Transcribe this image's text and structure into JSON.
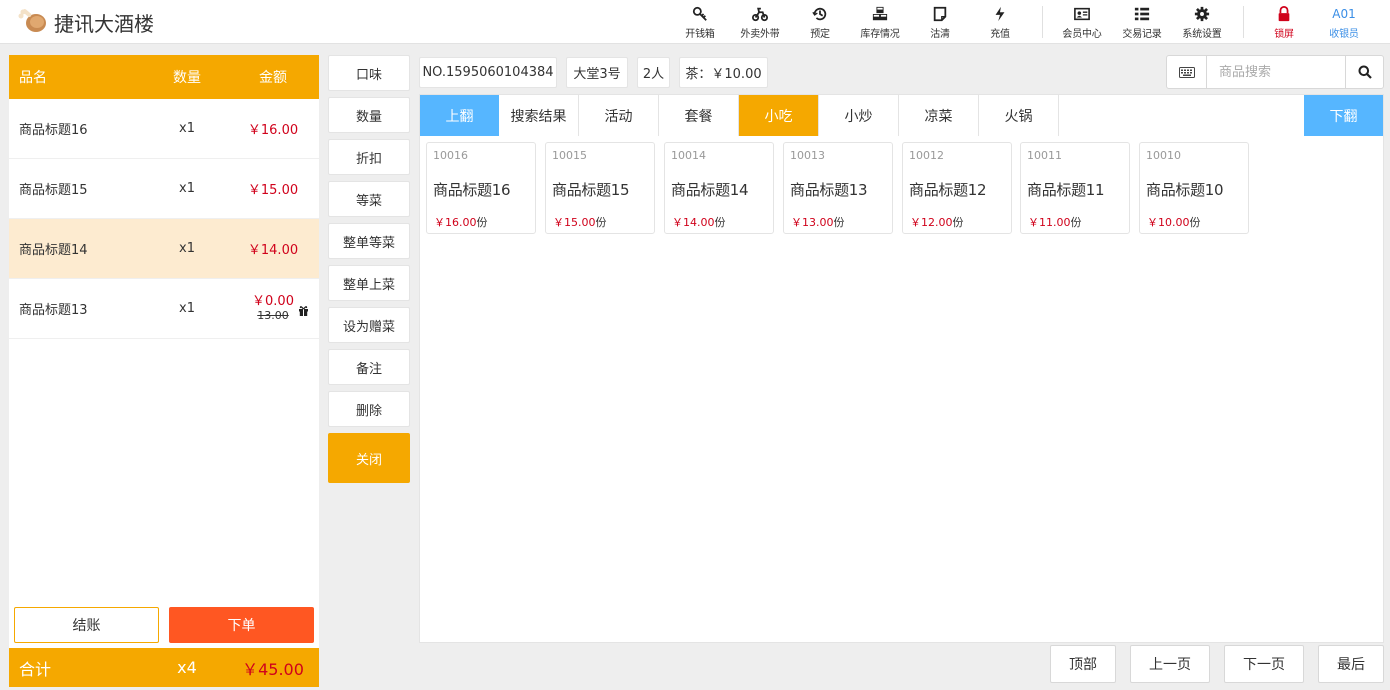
{
  "app": {
    "title": "捷讯大酒楼"
  },
  "toolbar": {
    "items": [
      {
        "label": "开钱箱",
        "icon": "key-icon"
      },
      {
        "label": "外卖外带",
        "icon": "scooter-icon"
      },
      {
        "label": "预定",
        "icon": "clock-history-icon"
      },
      {
        "label": "库存情况",
        "icon": "cubes-icon"
      },
      {
        "label": "沽清",
        "icon": "note-icon"
      },
      {
        "label": "充值",
        "icon": "bolt-icon"
      },
      {
        "label": "会员中心",
        "icon": "id-card-icon"
      },
      {
        "label": "交易记录",
        "icon": "list-icon"
      },
      {
        "label": "系统设置",
        "icon": "gear-icon"
      },
      {
        "label": "锁屏",
        "icon": "lock-icon"
      }
    ],
    "user": {
      "id": "A01",
      "role": "收银员"
    }
  },
  "order": {
    "headers": {
      "name": "品名",
      "qty": "数量",
      "amount": "金额"
    },
    "items": [
      {
        "name": "商品标题16",
        "qty": "x1",
        "amount": "￥16.00"
      },
      {
        "name": "商品标题15",
        "qty": "x1",
        "amount": "￥15.00"
      },
      {
        "name": "商品标题14",
        "qty": "x1",
        "amount": "￥14.00"
      },
      {
        "name": "商品标题13",
        "qty": "x1",
        "amount": "￥0.00",
        "original": "13.00"
      }
    ],
    "checkout_label": "结账",
    "place_order_label": "下单",
    "total": {
      "label": "合计",
      "qty": "x4",
      "amount": "￥45.00"
    }
  },
  "actions": [
    "口味",
    "数量",
    "折扣",
    "等菜",
    "整单等菜",
    "整单上菜",
    "设为赠菜",
    "备注",
    "删除",
    "关闭"
  ],
  "info": {
    "order_no": "NO.1595060104384",
    "table": "大堂3号",
    "guests": "2人",
    "tea": "茶：￥10.00"
  },
  "search": {
    "placeholder": "商品搜索"
  },
  "tabs": {
    "prev": "上翻",
    "next": "下翻",
    "items": [
      "搜索结果",
      "活动",
      "套餐",
      "小吃",
      "小炒",
      "凉菜",
      "火锅"
    ],
    "active": "小吃"
  },
  "products": [
    {
      "code": "10016",
      "name": "商品标题16",
      "price": "￥16.00",
      "unit": "份"
    },
    {
      "code": "10015",
      "name": "商品标题15",
      "price": "￥15.00",
      "unit": "份"
    },
    {
      "code": "10014",
      "name": "商品标题14",
      "price": "￥14.00",
      "unit": "份"
    },
    {
      "code": "10013",
      "name": "商品标题13",
      "price": "￥13.00",
      "unit": "份"
    },
    {
      "code": "10012",
      "name": "商品标题12",
      "price": "￥12.00",
      "unit": "份"
    },
    {
      "code": "10011",
      "name": "商品标题11",
      "price": "￥11.00",
      "unit": "份"
    },
    {
      "code": "10010",
      "name": "商品标题10",
      "price": "￥10.00",
      "unit": "份"
    }
  ],
  "pager": {
    "top": "顶部",
    "prev": "上一页",
    "next": "下一页",
    "last": "最后"
  },
  "colors": {
    "accent": "#f5a800",
    "order_button": "#ff5722",
    "nav_blue": "#56b6ff",
    "price_red": "#d0021b",
    "highlight_row": "#fdebd0"
  }
}
